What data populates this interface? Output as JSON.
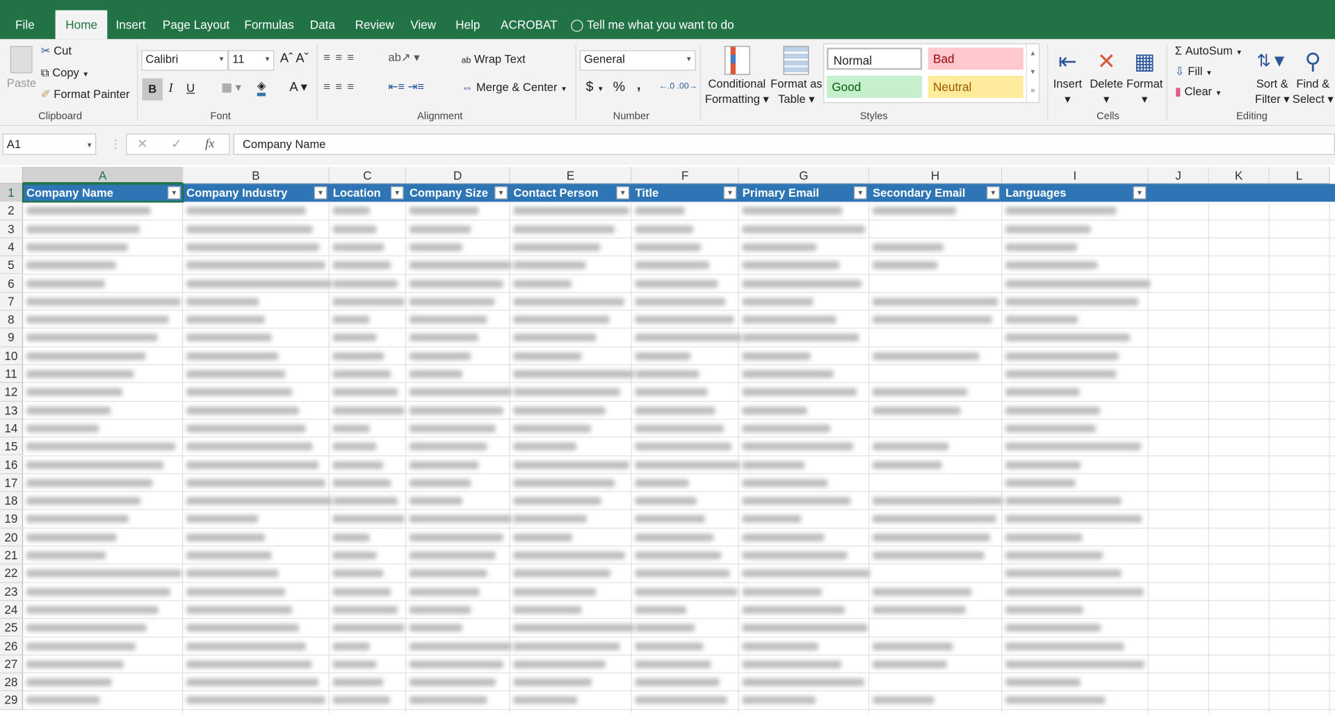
{
  "ribbon_tabs": [
    "File",
    "Home",
    "Insert",
    "Page Layout",
    "Formulas",
    "Data",
    "Review",
    "View",
    "Help",
    "ACROBAT"
  ],
  "tell_me": "Tell me what you want to do",
  "clipboard": {
    "paste": "Paste",
    "cut": "Cut",
    "copy": "Copy",
    "format_painter": "Format Painter",
    "label": "Clipboard"
  },
  "font": {
    "name": "Calibri",
    "size": "11",
    "bold": "B",
    "italic": "I",
    "underline": "U",
    "label": "Font"
  },
  "alignment": {
    "wrap": "Wrap Text",
    "merge": "Merge & Center",
    "label": "Alignment"
  },
  "number": {
    "format": "General",
    "currency": "$",
    "percent": "%",
    "comma": ",",
    "label": "Number"
  },
  "styles": {
    "conditional": "Conditional",
    "conditional2": "Formatting",
    "format_table": "Format as",
    "format_table2": "Table",
    "normal": "Normal",
    "bad": "Bad",
    "good": "Good",
    "neutral": "Neutral",
    "label": "Styles"
  },
  "cells": {
    "insert": "Insert",
    "delete": "Delete",
    "format": "Format",
    "label": "Cells"
  },
  "editing": {
    "autosum": "AutoSum",
    "fill": "Fill",
    "clear": "Clear",
    "sort": "Sort &",
    "sort2": "Filter",
    "find": "Find &",
    "find2": "Select",
    "label": "Editing"
  },
  "formula_bar": {
    "name_box": "A1",
    "fx": "fx",
    "value": "Company Name"
  },
  "columns": [
    "A",
    "B",
    "C",
    "D",
    "E",
    "F",
    "G",
    "H",
    "I",
    "J",
    "K",
    "L"
  ],
  "headers": [
    "Company Name",
    "Company Industry",
    "Location",
    "Company Size",
    "Contact Person",
    "Title",
    "Primary Email",
    "Secondary Email",
    "Languages"
  ],
  "rows": [
    "1",
    "2",
    "3",
    "4",
    "5",
    "6",
    "7",
    "8",
    "9",
    "10",
    "11",
    "12",
    "13",
    "14",
    "15",
    "16",
    "17",
    "18",
    "19",
    "20",
    "21",
    "22",
    "23",
    "24",
    "25",
    "26",
    "27",
    "28",
    "29"
  ],
  "colors": {
    "accent": "#217346",
    "header_fill": "#2e75b6"
  }
}
